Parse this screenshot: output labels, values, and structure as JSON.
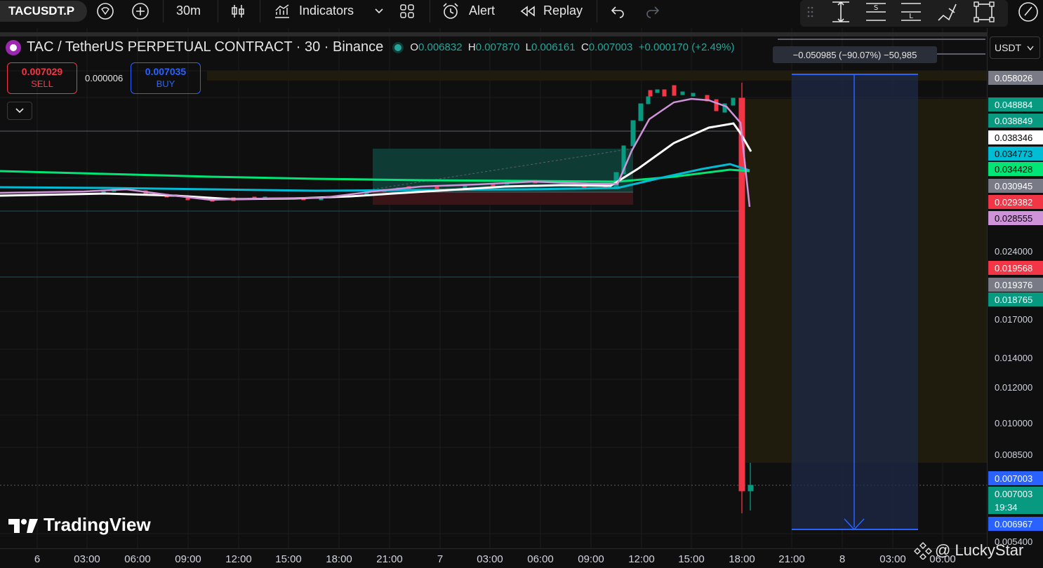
{
  "toolbar": {
    "symbol": "TACUSDT.P",
    "interval": "30m",
    "indicators_label": "Indicators",
    "alert_label": "Alert",
    "replay_label": "Replay"
  },
  "legend": {
    "title": "TAC / TetherUS PERPETUAL CONTRACT · 30 · Binance",
    "open_key": "O",
    "open": "0.006832",
    "high_key": "H",
    "high": "0.007870",
    "low_key": "L",
    "low": "0.006161",
    "close_key": "C",
    "close": "0.007003",
    "change": "+0.000170 (+2.49%)"
  },
  "trade": {
    "sell_price": "0.007029",
    "sell_label": "SELL",
    "spread": "0.000006",
    "buy_price": "0.007035",
    "buy_label": "BUY"
  },
  "measure_tip": "−0.050985 (−90.07%) −50,985",
  "currency": "USDT",
  "price_labels": [
    {
      "text": "0.058026",
      "bg": "#787b86",
      "color": "#ffffff"
    },
    {
      "text": "0.048884",
      "bg": "#089981",
      "color": "#ffffff"
    },
    {
      "text": "0.038849",
      "bg": "#089981",
      "color": "#ffffff"
    },
    {
      "text": "0.038346",
      "bg": "#ffffff",
      "color": "#000000"
    },
    {
      "text": "0.034773",
      "bg": "#00bcd4",
      "color": "#000000"
    },
    {
      "text": "0.034428",
      "bg": "#00e676",
      "color": "#000000"
    },
    {
      "text": "0.030945",
      "bg": "#787b86",
      "color": "#ffffff"
    },
    {
      "text": "0.029382",
      "bg": "#f23645",
      "color": "#ffffff"
    },
    {
      "text": "0.028555",
      "bg": "#ce93d8",
      "color": "#000000"
    },
    {
      "text": "0.024000",
      "bg": "",
      "color": "#d1d4dc"
    },
    {
      "text": "0.019568",
      "bg": "#f23645",
      "color": "#ffffff"
    },
    {
      "text": "0.019376",
      "bg": "#787b86",
      "color": "#ffffff"
    },
    {
      "text": "0.018765",
      "bg": "#089981",
      "color": "#ffffff"
    },
    {
      "text": "0.017000",
      "bg": "",
      "color": "#d1d4dc"
    },
    {
      "text": "0.014000",
      "bg": "",
      "color": "#d1d4dc"
    },
    {
      "text": "0.012000",
      "bg": "",
      "color": "#d1d4dc"
    },
    {
      "text": "0.010000",
      "bg": "",
      "color": "#d1d4dc"
    },
    {
      "text": "0.008500",
      "bg": "",
      "color": "#d1d4dc"
    },
    {
      "text": "0.007003",
      "bg": "#2962ff",
      "color": "#ffffff"
    },
    {
      "text": "0.007003",
      "bg": "#089981",
      "color": "#ffffff"
    },
    {
      "text": "19:34",
      "bg": "#089981",
      "color": "#ffffff"
    },
    {
      "text": "0.006967",
      "bg": "#2962ff",
      "color": "#ffffff"
    },
    {
      "text": "0.005400",
      "bg": "",
      "color": "#d1d4dc"
    }
  ],
  "time_labels": [
    "6",
    "03:00",
    "06:00",
    "09:00",
    "12:00",
    "15:00",
    "18:00",
    "21:00",
    "7",
    "03:00",
    "06:00",
    "09:00",
    "12:00",
    "15:00",
    "18:00",
    "21:00",
    "8",
    "03:00",
    "06:00"
  ],
  "brand": "TradingView",
  "watermark": "@ LuckyStar",
  "colors": {
    "up": "#089981",
    "down": "#f23645",
    "ema_green": "#00e676",
    "ema_cyan": "#00bcd4",
    "ema_white": "#ffffff",
    "ema_pink": "#ce93d8",
    "measure": "#2962ff"
  }
}
